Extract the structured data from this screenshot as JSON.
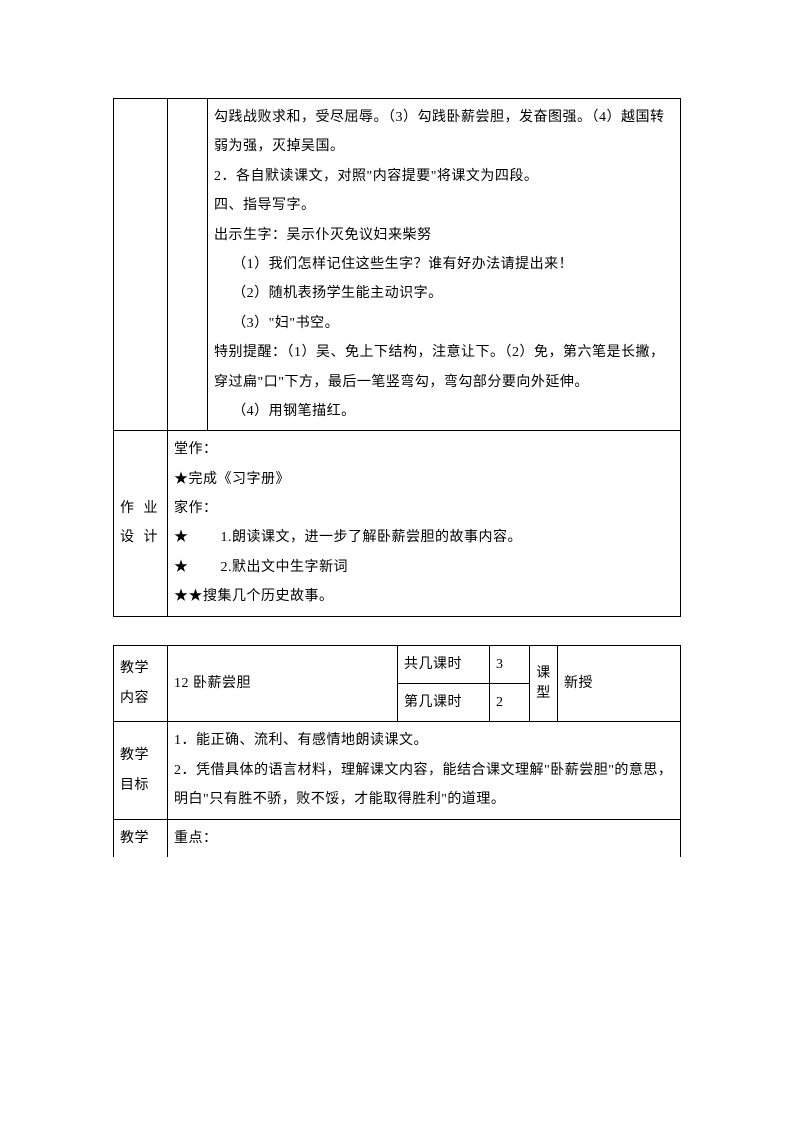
{
  "upper": {
    "right_col": {
      "p1": "勾践战败求和，受尽屈辱。（3）勾践卧薪尝胆，发奋图强。（4）越国转弱为强，灭掉吴国。",
      "p2": "2．各自默读课文，对照\"内容提要\"将课文为四段。",
      "p3": "四、指导写字。",
      "p4": "出示生字：吴示仆灭免议妇来柴努",
      "p5": "（1）我们怎样记住这些生字？谁有好办法请提出来！",
      "p6": "（2）随机表扬学生能主动识字。",
      "p7": "（3）\"妇\"书空。",
      "p8": "特别提醒：（1）吴、免上下结构，注意让下。（2）免，第六笔是长撇，穿过扁\"口\"下方，最后一笔竖弯勾，弯勾部分要向外延伸。",
      "p9": "（4）用钢笔描红。"
    },
    "homework_label": "作 业设 计",
    "homework": {
      "l1": "堂作：",
      "l2": "★完成《习字册》",
      "l3": "家作：",
      "l4": "★        1.朗读课文，进一步了解卧薪尝胆的故事内容。",
      "l5": "★        2.默出文中生字新词",
      "l6": "★★搜集几个历史故事。"
    }
  },
  "lower": {
    "content_label": "教学内容",
    "title": "12 卧薪尝胆",
    "total_periods_label": "共几课时",
    "total_periods": "3",
    "which_period_label": "第几课时",
    "which_period": "2",
    "type_label": "课型",
    "type_value": "新授",
    "goal_label": "教学目标",
    "goal_text": "1．能正确、流利、有感情地朗读课文。\n2．凭借具体的语言材料，理解课文内容，能结合课文理解\"卧薪尝胆\"的意思，明白\"只有胜不骄，败不馁，才能取得胜利\"的道理。",
    "teach_label": "教学",
    "focus_label": "重点："
  }
}
